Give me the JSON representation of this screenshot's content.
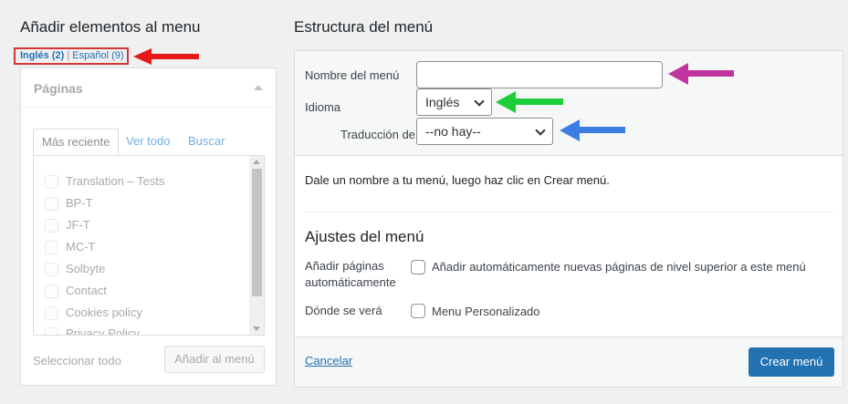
{
  "left": {
    "title": "Añadir elementos al menu",
    "languages": {
      "current": "Inglés (2)",
      "separator": "|",
      "other": "Español (9)"
    },
    "paginas": {
      "title": "Páginas",
      "tabs": [
        "Más reciente",
        "Ver todo",
        "Buscar"
      ],
      "items": [
        "Translation – Tests",
        "BP-T",
        "JF-T",
        "MC-T",
        "Solbyte",
        "Contact",
        "Cookies policy",
        "Privacy Policy"
      ],
      "select_all": "Seleccionar todo",
      "add_button": "Añadir al menú"
    }
  },
  "right": {
    "title": "Estructura del menú",
    "form": {
      "name_label": "Nombre del menú",
      "name_value": "",
      "language_label": "Idioma",
      "language_value": "Inglés",
      "translation_label": "Traducción de",
      "translation_value": "--no hay--"
    },
    "instructions": "Dale un nombre a tu menú, luego haz clic en Crear menú.",
    "settings": {
      "title": "Ajustes del menú",
      "auto_add_label_line1": "Añadir páginas",
      "auto_add_label_line2": "automáticamente",
      "auto_add_option": "Añadir automáticamente nuevas páginas de nivel superior a este menú",
      "location_label": "Dónde se verá",
      "location_option": "Menu Personalizado"
    },
    "footer": {
      "cancel": "Cancelar",
      "create": "Crear menú"
    }
  },
  "colors": {
    "accent": "#2271b1",
    "arrow_red": "#e8191b",
    "arrow_magenta": "#c1349e",
    "arrow_green": "#1bce3a",
    "arrow_blue": "#3a7de3"
  }
}
